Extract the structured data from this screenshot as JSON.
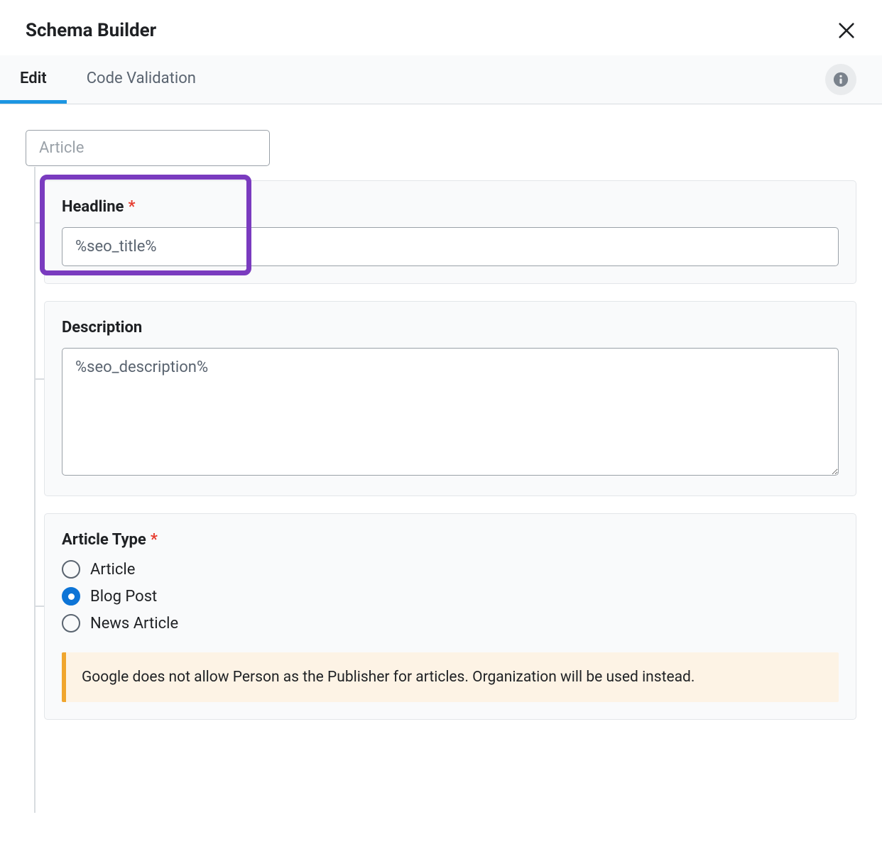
{
  "header": {
    "title": "Schema Builder"
  },
  "tabs": {
    "edit": "Edit",
    "code_validation": "Code Validation"
  },
  "schema_type": {
    "value": "Article"
  },
  "fields": {
    "headline": {
      "label": "Headline",
      "value": "%seo_title%"
    },
    "description": {
      "label": "Description",
      "value": "%seo_description%"
    },
    "article_type": {
      "label": "Article Type",
      "options": {
        "article": "Article",
        "blog_post": "Blog Post",
        "news_article": "News Article"
      },
      "selected": "blog_post",
      "notice": "Google does not allow Person as the Publisher for articles. Organization will be used instead."
    }
  }
}
